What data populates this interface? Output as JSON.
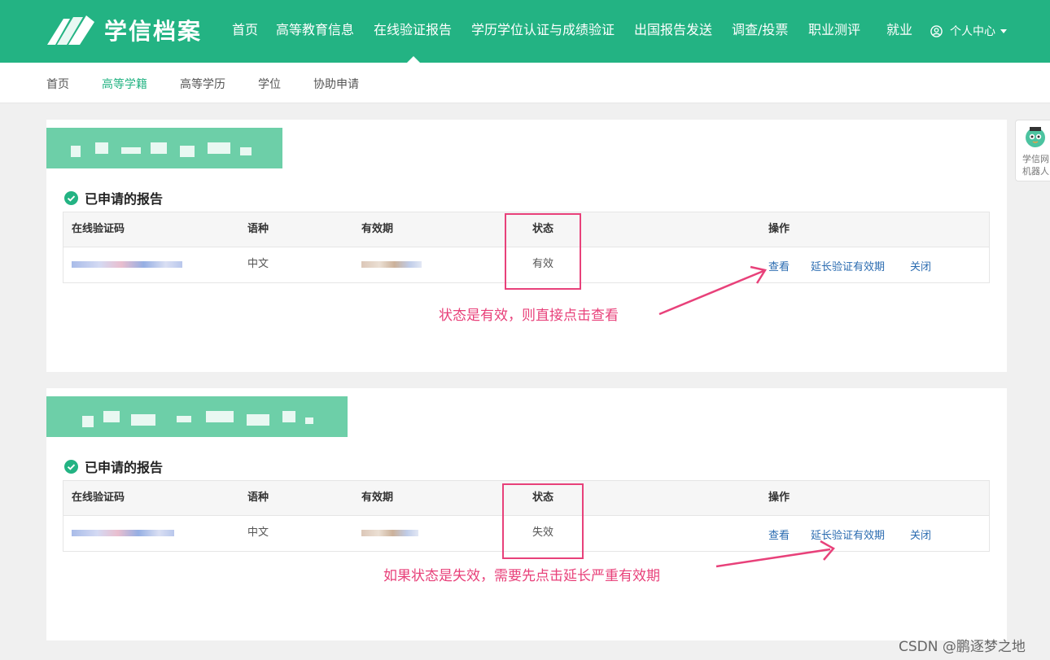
{
  "header": {
    "logo_text": "学信档案",
    "nav": [
      "首页",
      "高等教育信息",
      "在线验证报告",
      "学历学位认证与成绩验证",
      "出国报告发送",
      "调查/投票",
      "职业测评",
      "就业"
    ],
    "user_menu": "个人中心",
    "active_nav": "在线验证报告"
  },
  "subnav": {
    "items": [
      "首页",
      "高等学籍",
      "高等学历",
      "学位",
      "协助申请"
    ],
    "active": "高等学籍"
  },
  "cards": [
    {
      "section_title": "已申请的报告",
      "columns": [
        "在线验证码",
        "语种",
        "有效期",
        "状态",
        "操作"
      ],
      "row": {
        "language": "中文",
        "status": "有效",
        "actions": [
          "查看",
          "延长验证有效期",
          "关闭"
        ]
      },
      "annotation": "状态是有效，则直接点击查看"
    },
    {
      "section_title": "已申请的报告",
      "columns": [
        "在线验证码",
        "语种",
        "有效期",
        "状态",
        "操作"
      ],
      "row": {
        "language": "中文",
        "status": "失效",
        "actions": [
          "查看",
          "延长验证有效期",
          "关闭"
        ]
      },
      "annotation": "如果状态是失效，需要先点击延长严重有效期"
    }
  ],
  "robot": {
    "line1": "学信网",
    "line2": "机器人"
  },
  "watermark": "CSDN @鹏逐梦之地",
  "colors": {
    "brand": "#23b383",
    "annotation": "#e8417a",
    "link": "#2a6bb0"
  }
}
